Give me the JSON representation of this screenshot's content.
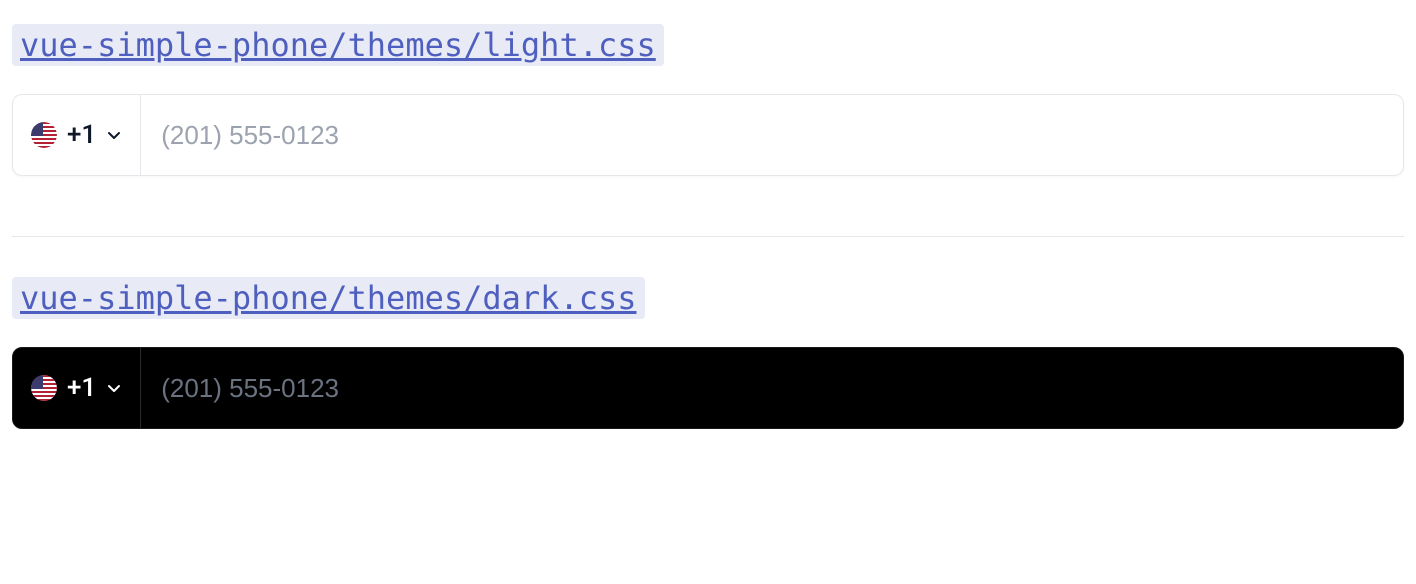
{
  "themes": {
    "light": {
      "link_text": "vue-simple-phone/themes/light.css",
      "dial_code": "+1",
      "placeholder": "(201) 555-0123",
      "flag_country": "us"
    },
    "dark": {
      "link_text": "vue-simple-phone/themes/dark.css",
      "dial_code": "+1",
      "placeholder": "(201) 555-0123",
      "flag_country": "us"
    }
  }
}
